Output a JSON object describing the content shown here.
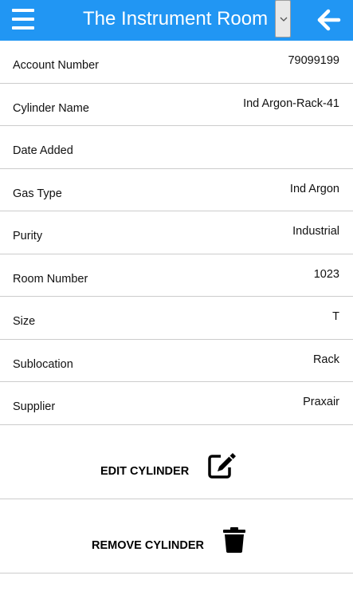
{
  "header": {
    "title": "The Instrument Room",
    "background_color": "#2196f3",
    "menu_icon": "hamburger-menu-icon",
    "dropdown_icon": "chevron-down-icon",
    "back_icon": "arrow-left-icon"
  },
  "details": [
    {
      "label": "Account Number",
      "value": "79099199"
    },
    {
      "label": "Cylinder Name",
      "value": "Ind Argon-Rack-41"
    },
    {
      "label": "Date Added",
      "value": ""
    },
    {
      "label": "Gas Type",
      "value": "Ind Argon"
    },
    {
      "label": "Purity",
      "value": "Industrial"
    },
    {
      "label": "Room Number",
      "value": "1023"
    },
    {
      "label": "Size",
      "value": "T"
    },
    {
      "label": "Sublocation",
      "value": "Rack"
    },
    {
      "label": "Supplier",
      "value": "Praxair"
    }
  ],
  "actions": {
    "edit": {
      "label": "EDIT CYLINDER",
      "icon": "edit-icon"
    },
    "remove": {
      "label": "REMOVE CYLINDER",
      "icon": "trash-icon"
    }
  }
}
